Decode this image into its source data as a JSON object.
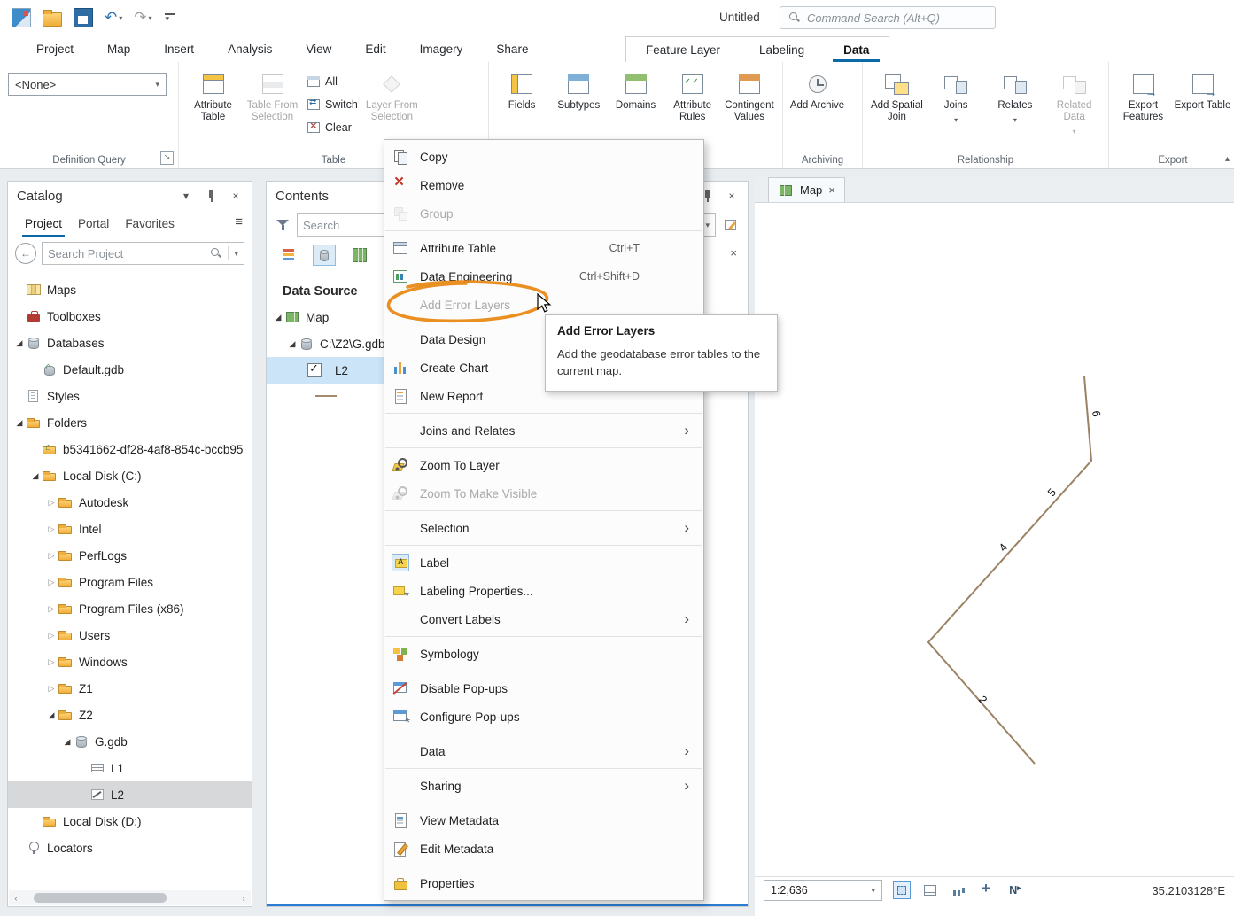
{
  "titlebar": {
    "title": "Untitled",
    "command_search_placeholder": "Command Search (Alt+Q)"
  },
  "ribbon": {
    "tabs": [
      {
        "label": "Project"
      },
      {
        "label": "Map"
      },
      {
        "label": "Insert"
      },
      {
        "label": "Analysis"
      },
      {
        "label": "View"
      },
      {
        "label": "Edit"
      },
      {
        "label": "Imagery"
      },
      {
        "label": "Share"
      }
    ],
    "contextual_tabs": [
      {
        "label": "Feature Layer"
      },
      {
        "label": "Labeling"
      },
      {
        "label": "Data",
        "active": true
      }
    ],
    "definition_query_group": {
      "label": "Definition Query",
      "value": "<None>"
    },
    "table_group": {
      "label": "Table",
      "big_left": [
        {
          "label": "Attribute Table",
          "icon": "attribute-table"
        },
        {
          "label": "Table From Selection",
          "icon": "table-from-selection",
          "disabled": true
        }
      ],
      "small": [
        {
          "label": "All",
          "icon": "small-table"
        },
        {
          "label": "Switch",
          "icon": "small-switch"
        },
        {
          "label": "Clear",
          "icon": "small-clear"
        }
      ],
      "big_right": [
        {
          "label": "Layer From Selection",
          "icon": "layer-from-selection",
          "disabled": true
        }
      ]
    },
    "data_design_group": {
      "label": "",
      "buttons": [
        {
          "label": "Fields",
          "icon": "fields"
        },
        {
          "label": "Subtypes",
          "icon": "subtypes"
        },
        {
          "label": "Domains",
          "icon": "domains"
        },
        {
          "label": "Attribute Rules",
          "icon": "attribute-rules"
        },
        {
          "label": "Contingent Values",
          "icon": "contingent-values"
        }
      ]
    },
    "archiving_group": {
      "label": "Archiving",
      "buttons": [
        {
          "label": "Add Archive",
          "icon": "add-archive"
        }
      ]
    },
    "relationship_group": {
      "label": "Relationship",
      "buttons": [
        {
          "label": "Add Spatial Join",
          "icon": "add-spatial-join"
        },
        {
          "label": "Joins",
          "icon": "joins",
          "dropdown": true
        },
        {
          "label": "Relates",
          "icon": "relates",
          "dropdown": true
        },
        {
          "label": "Related Data",
          "icon": "related-data",
          "dropdown": true,
          "disabled": true
        }
      ]
    },
    "export_group": {
      "label": "Export",
      "buttons": [
        {
          "label": "Export Features",
          "icon": "export-features"
        },
        {
          "label": "Export Table",
          "icon": "export-table"
        }
      ]
    }
  },
  "catalog": {
    "title": "Catalog",
    "tabs": [
      {
        "label": "Project",
        "active": true
      },
      {
        "label": "Portal"
      },
      {
        "label": "Favorites"
      }
    ],
    "search_placeholder": "Search Project",
    "tree": [
      {
        "label": "Maps",
        "level": 0,
        "icon": "maps"
      },
      {
        "label": "Toolboxes",
        "level": 0,
        "icon": "toolbox"
      },
      {
        "label": "Databases",
        "level": 0,
        "icon": "databases",
        "expander": "expanded"
      },
      {
        "label": "Default.gdb",
        "level": 1,
        "icon": "gdb-home"
      },
      {
        "label": "Styles",
        "level": 0,
        "icon": "styles"
      },
      {
        "label": "Folders",
        "level": 0,
        "icon": "folders",
        "expander": "expanded"
      },
      {
        "label": "b5341662-df28-4af8-854c-bccb95",
        "level": 1,
        "icon": "folder-home"
      },
      {
        "label": "Local Disk (C:)",
        "level": 1,
        "icon": "folder",
        "expander": "expanded"
      },
      {
        "label": "Autodesk",
        "level": 2,
        "icon": "folder",
        "expander": "collapsed"
      },
      {
        "label": "Intel",
        "level": 2,
        "icon": "folder",
        "expander": "collapsed"
      },
      {
        "label": "PerfLogs",
        "level": 2,
        "icon": "folder",
        "expander": "collapsed"
      },
      {
        "label": "Program Files",
        "level": 2,
        "icon": "folder",
        "expander": "collapsed"
      },
      {
        "label": "Program Files (x86)",
        "level": 2,
        "icon": "folder",
        "expander": "collapsed"
      },
      {
        "label": "Users",
        "level": 2,
        "icon": "folder",
        "expander": "collapsed"
      },
      {
        "label": "Windows",
        "level": 2,
        "icon": "folder",
        "expander": "collapsed"
      },
      {
        "label": "Z1",
        "level": 2,
        "icon": "folder",
        "expander": "collapsed"
      },
      {
        "label": "Z2",
        "level": 2,
        "icon": "folder",
        "expander": "expanded"
      },
      {
        "label": "G.gdb",
        "level": 3,
        "icon": "gdb",
        "expander": "expanded"
      },
      {
        "label": "L1",
        "level": 4,
        "icon": "table-item"
      },
      {
        "label": "L2",
        "level": 4,
        "icon": "line-layer",
        "selected": true
      },
      {
        "label": "Local Disk (D:)",
        "level": 1,
        "icon": "folder"
      },
      {
        "label": "Locators",
        "level": 0,
        "icon": "locators"
      }
    ]
  },
  "contents": {
    "title": "Contents",
    "search_placeholder": "Search",
    "section_label": "Data Source",
    "tree": [
      {
        "label": "Map",
        "icon": "map"
      },
      {
        "label": "C:\\Z2\\G.gdb",
        "icon": "gdb"
      },
      {
        "label": "L2",
        "checked": true,
        "selected": true
      }
    ],
    "layer_symbol_color": "#a5896b"
  },
  "context_menu": {
    "items": [
      {
        "label": "Copy",
        "icon": "copy"
      },
      {
        "label": "Remove",
        "icon": "remove"
      },
      {
        "label": "Group",
        "icon": "group",
        "disabled": true
      },
      {
        "separator": true
      },
      {
        "label": "Attribute Table",
        "icon": "attribute-table",
        "shortcut": "Ctrl+T"
      },
      {
        "label": "Data Engineering",
        "icon": "data-engineering",
        "shortcut": "Ctrl+Shift+D"
      },
      {
        "label": "Add Error Layers",
        "disabled": true
      },
      {
        "separator": true
      },
      {
        "label": "Data Design",
        "submenu": true
      },
      {
        "label": "Create Chart",
        "icon": "create-chart",
        "submenu": true
      },
      {
        "label": "New Report",
        "icon": "new-report"
      },
      {
        "separator": true
      },
      {
        "label": "Joins and Relates",
        "submenu": true
      },
      {
        "separator": true
      },
      {
        "label": "Zoom To Layer",
        "icon": "zoom-to-layer"
      },
      {
        "label": "Zoom To Make Visible",
        "icon": "zoom-visible",
        "disabled": true
      },
      {
        "separator": true
      },
      {
        "label": "Selection",
        "submenu": true
      },
      {
        "separator": true
      },
      {
        "label": "Label",
        "icon": "label"
      },
      {
        "label": "Labeling Properties...",
        "icon": "labeling-properties"
      },
      {
        "label": "Convert Labels",
        "submenu": true
      },
      {
        "separator": true
      },
      {
        "label": "Symbology",
        "icon": "symbology"
      },
      {
        "separator": true
      },
      {
        "label": "Disable Pop-ups",
        "icon": "disable-popups"
      },
      {
        "label": "Configure Pop-ups",
        "icon": "configure-popups"
      },
      {
        "separator": true
      },
      {
        "label": "Data",
        "submenu": true
      },
      {
        "separator": true
      },
      {
        "label": "Sharing",
        "submenu": true
      },
      {
        "separator": true
      },
      {
        "label": "View Metadata",
        "icon": "view-metadata"
      },
      {
        "label": "Edit Metadata",
        "icon": "edit-metadata"
      },
      {
        "separator": true
      },
      {
        "label": "Properties",
        "icon": "properties"
      }
    ]
  },
  "tooltip": {
    "title": "Add Error Layers",
    "body": "Add the geodatabase error tables to the current map."
  },
  "map_view": {
    "tab_label": "Map",
    "scale": "1:2,636",
    "coordinates": "35.2103128°E",
    "line_color": "#9b8264",
    "feature_labels": [
      {
        "text": "6"
      },
      {
        "text": "5"
      },
      {
        "text": "4"
      },
      {
        "text": "2"
      }
    ]
  }
}
